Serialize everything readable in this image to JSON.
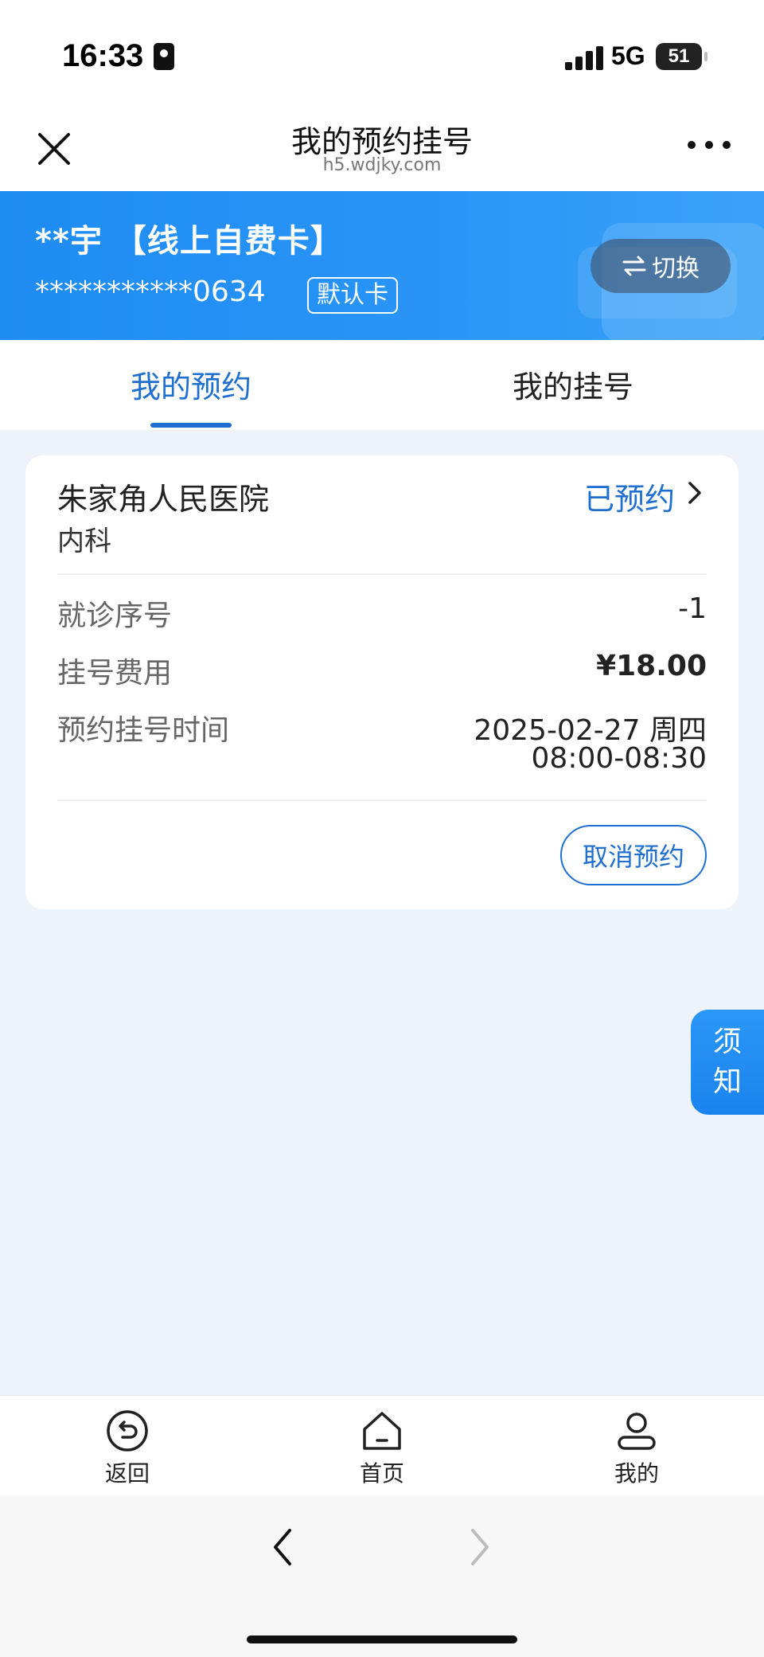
{
  "status_bar": {
    "time": "16:33",
    "network": "5G",
    "battery": "51"
  },
  "nav": {
    "title": "我的预约挂号",
    "url": "h5.wdjky.com"
  },
  "card": {
    "holder_name": "**宇  【线上自费卡】",
    "number": "***********0634",
    "default_badge": "默认卡",
    "switch_label": "切换"
  },
  "tabs": [
    {
      "label": "我的预约",
      "active": true
    },
    {
      "label": "我的挂号",
      "active": false
    }
  ],
  "appointment": {
    "hospital": "朱家角人民医院",
    "department": "内科",
    "status": "已预约",
    "rows": [
      {
        "label": "就诊序号",
        "value": "-1"
      },
      {
        "label": "挂号费用",
        "value": "¥18.00"
      },
      {
        "label": "预约挂号时间",
        "value_line1": "2025-02-27 周四",
        "value_line2": "08:00-08:30"
      }
    ],
    "cancel_label": "取消预约"
  },
  "notice": {
    "line1": "须",
    "line2": "知"
  },
  "toolbar": {
    "back_label": "返回",
    "home_label": "首页",
    "mine_label": "我的"
  },
  "colors": {
    "accent": "#1f6fd0",
    "banner": "#2a95f6",
    "page_bg": "#eef3fb"
  }
}
